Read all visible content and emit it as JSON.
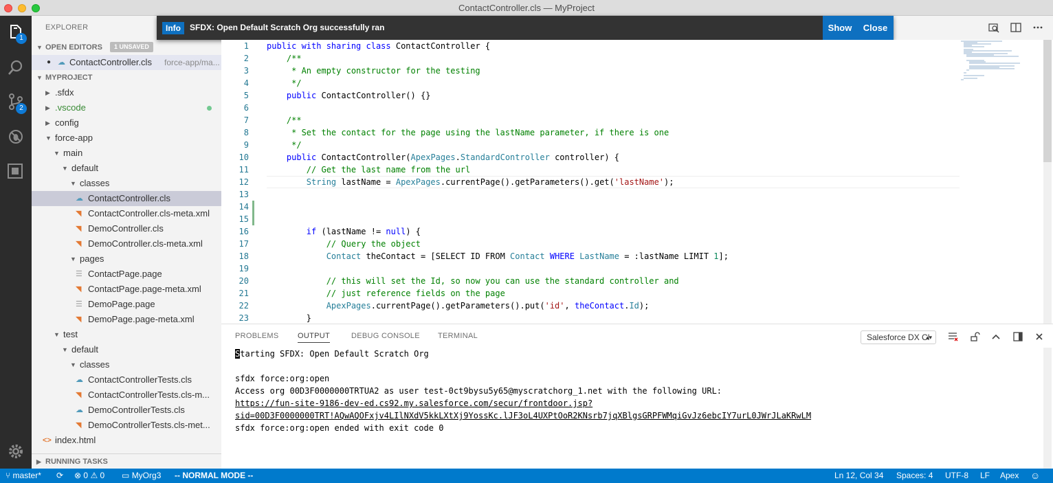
{
  "window": {
    "title": "ContactController.cls — MyProject"
  },
  "activity_bar": {
    "explorer_badge": "1",
    "scm_badge": "2"
  },
  "explorer": {
    "title": "EXPLORER",
    "open_editors": {
      "label": "OPEN EDITORS",
      "badge": "1 UNSAVED",
      "files": [
        {
          "name": "ContactController.cls",
          "path": "force-app/ma..."
        }
      ]
    },
    "project": {
      "label": "MYPROJECT",
      "items": [
        {
          "label": ".sfdx",
          "kind": "folder"
        },
        {
          "label": ".vscode",
          "kind": "folder"
        },
        {
          "label": "config",
          "kind": "folder"
        },
        {
          "label": "force-app",
          "kind": "folder-open"
        },
        {
          "label": "main",
          "kind": "folder-open"
        },
        {
          "label": "default",
          "kind": "folder-open"
        },
        {
          "label": "classes",
          "kind": "folder-open"
        },
        {
          "label": "ContactController.cls",
          "kind": "apex"
        },
        {
          "label": "ContactController.cls-meta.xml",
          "kind": "xml"
        },
        {
          "label": "DemoController.cls",
          "kind": "xml"
        },
        {
          "label": "DemoController.cls-meta.xml",
          "kind": "xml"
        },
        {
          "label": "pages",
          "kind": "folder-open"
        },
        {
          "label": "ContactPage.page",
          "kind": "page"
        },
        {
          "label": "ContactPage.page-meta.xml",
          "kind": "xml"
        },
        {
          "label": "DemoPage.page",
          "kind": "page"
        },
        {
          "label": "DemoPage.page-meta.xml",
          "kind": "xml"
        },
        {
          "label": "test",
          "kind": "folder-open"
        },
        {
          "label": "default",
          "kind": "folder-open"
        },
        {
          "label": "classes",
          "kind": "folder-open"
        },
        {
          "label": "ContactControllerTests.cls",
          "kind": "apex"
        },
        {
          "label": "ContactControllerTests.cls-m...",
          "kind": "xml"
        },
        {
          "label": "DemoControllerTests.cls",
          "kind": "apex"
        },
        {
          "label": "DemoControllerTests.cls-met...",
          "kind": "xml"
        },
        {
          "label": "index.html",
          "kind": "html"
        }
      ]
    },
    "running_tasks": "RUNNING TASKS"
  },
  "notification": {
    "badge": "Info",
    "message": "SFDX: Open Default Scratch Org successfully ran",
    "show_label": "Show",
    "close_label": "Close"
  },
  "editor": {
    "line_numbers": [
      "1",
      "2",
      "3",
      "4",
      "5",
      "6",
      "7",
      "8",
      "9",
      "10",
      "11",
      "12",
      "13",
      "14",
      "15",
      "16",
      "17",
      "18",
      "19",
      "20",
      "21",
      "22",
      "23"
    ]
  },
  "panel": {
    "tabs": [
      "PROBLEMS",
      "OUTPUT",
      "DEBUG CONSOLE",
      "TERMINAL"
    ],
    "channel": "Salesforce DX Cl",
    "output": {
      "line1_cursor": "S",
      "line1_rest": "tarting SFDX: Open Default Scratch Org",
      "line3": "sfdx force:org:open",
      "line4": "Access org 00D3F0000000TRTUA2 as user test-0ct9bysu5y65@myscratchorg_1.net with the following URL:",
      "line5": "https://fun-site-9186-dev-ed.cs92.my.salesforce.com/secur/frontdoor.jsp?",
      "line6": "sid=00D3F0000000TRT!AQwAQOFxjv4LIlNXdV5kkLXtXj9YossKc.lJF3oL4UXPtOoR2KNsrb7jqXBlgsGRPFWMqiGvJz6ebcIY7urL0JWrJLaKRwLM",
      "line7": "sfdx force:org:open ended with exit code 0"
    }
  },
  "status": {
    "branch": "master*",
    "errors": "0",
    "warnings": "0",
    "org": "MyOrg3",
    "mode": "-- NORMAL MODE --",
    "position": "Ln 12, Col 34",
    "spaces": "Spaces: 4",
    "encoding": "UTF-8",
    "eol": "LF",
    "language": "Apex"
  },
  "colors": {
    "statusbar": "#007acc",
    "activitybar": "#2c2c2c",
    "sidebar": "#f3f3f3",
    "info_badge": "#0e70c0"
  }
}
